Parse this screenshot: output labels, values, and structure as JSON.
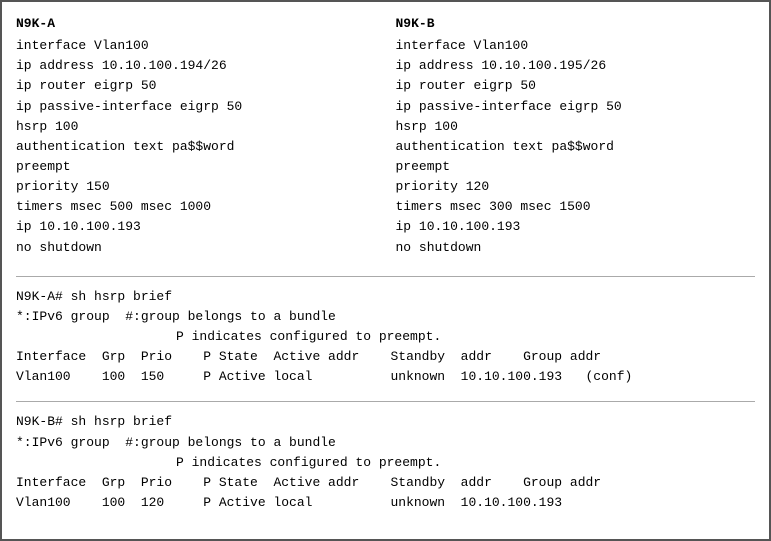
{
  "nodes": {
    "left": {
      "title": "N9K-A",
      "lines": [
        "interface Vlan100",
        "ip address 10.10.100.194/26",
        "ip router eigrp 50",
        "ip passive-interface eigrp 50",
        "hsrp 100",
        "authentication text pa$$word",
        "preempt",
        "priority 150",
        "timers msec 500 msec 1000",
        "ip 10.10.100.193",
        "no shutdown"
      ]
    },
    "right": {
      "title": "N9K-B",
      "lines": [
        "interface Vlan100",
        "ip address 10.10.100.195/26",
        "ip router eigrp 50",
        "ip passive-interface eigrp 50",
        "hsrp 100",
        "authentication text pa$$word",
        "preempt",
        "priority 120",
        "timers msec 300 msec 1500",
        "ip 10.10.100.193",
        "no shutdown"
      ]
    }
  },
  "hsrp_a": {
    "prompt": "N9K-A# sh hsrp brief",
    "legend1": "*:IPv6 group  #:group belongs to a bundle",
    "legend2": "P indicates configured to preempt.",
    "header": "Interface  Grp  Prio    P State  Active addr    Standby  addr    Group addr",
    "data": "Vlan100    100  150     P Active local          unknown  10.10.100.193   (conf)"
  },
  "hsrp_b": {
    "prompt": "N9K-B# sh hsrp brief",
    "legend1": "*:IPv6 group  #:group belongs to a bundle",
    "legend2": "P indicates configured to preempt.",
    "header": "Interface  Grp  Prio    P State  Active addr    Standby  addr    Group addr",
    "data": "Vlan100    100  120     P Active local          unknown  10.10.100.193"
  }
}
